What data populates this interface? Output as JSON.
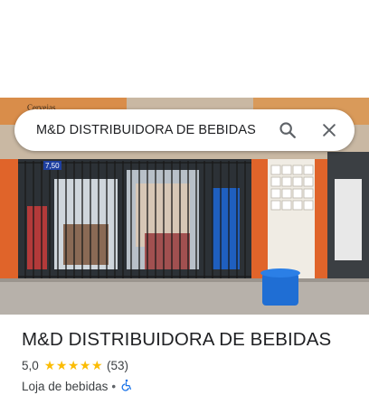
{
  "search": {
    "query": "M&D DISTRIBUIDORA DE BEBIDAS",
    "search_icon": "search-icon",
    "close_icon": "close-icon"
  },
  "photo": {
    "sign_text": "Cervejas",
    "price_tag": "7,50"
  },
  "place": {
    "name": "M&D DISTRIBUIDORA DE BEBIDAS",
    "rating": "5,0",
    "stars": "★★★★★",
    "review_count": "(53)",
    "category": "Loja de bebidas",
    "separator": "•",
    "accessibility_icon": "wheelchair-icon"
  },
  "colors": {
    "accent_blue": "#1a73e8",
    "star_yellow": "#fbbc04",
    "title_text": "#202124",
    "secondary_text": "#3c4043"
  }
}
